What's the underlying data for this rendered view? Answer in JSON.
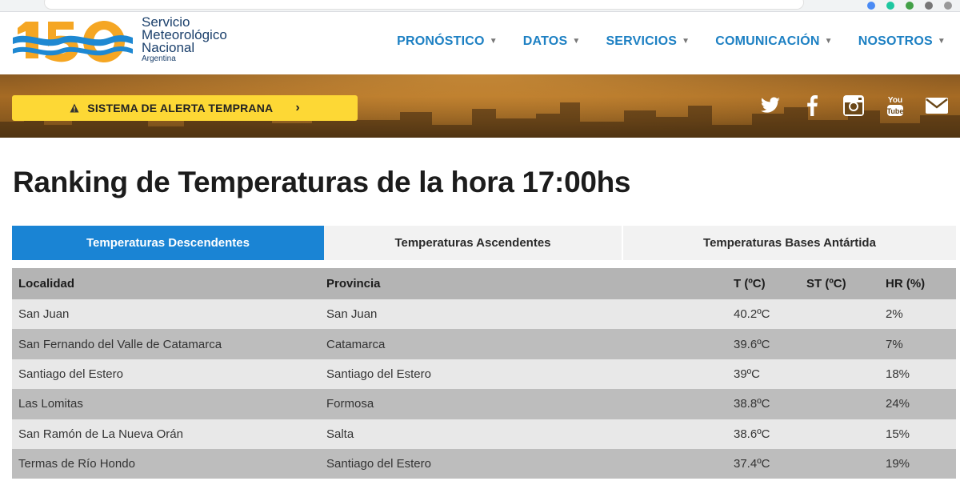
{
  "header": {
    "logo": {
      "number": "150",
      "line1": "Servicio",
      "line2": "Meteorológico",
      "line3": "Nacional",
      "line4": "Argentina"
    },
    "nav": [
      {
        "label": "PRONÓSTICO"
      },
      {
        "label": "DATOS"
      },
      {
        "label": "SERVICIOS"
      },
      {
        "label": "COMUNICACIÓN"
      },
      {
        "label": "NOSOTROS"
      }
    ]
  },
  "hero": {
    "alert_label": "SISTEMA DE ALERTA TEMPRANA",
    "social": [
      "twitter-icon",
      "facebook-icon",
      "instagram-icon",
      "youtube-icon",
      "email-icon"
    ]
  },
  "page": {
    "title": "Ranking de Temperaturas de la hora 17:00hs"
  },
  "tabs": [
    {
      "label": "Temperaturas Descendentes",
      "active": true
    },
    {
      "label": "Temperaturas Ascendentes",
      "active": false
    },
    {
      "label": "Temperaturas Bases Antártida",
      "active": false
    }
  ],
  "table": {
    "columns": [
      "Localidad",
      "Provincia",
      "T (ºC)",
      "ST (ºC)",
      "HR (%)"
    ],
    "rows": [
      {
        "localidad": "San Juan",
        "provincia": "San Juan",
        "t": "40.2ºC",
        "st": "",
        "hr": "2%"
      },
      {
        "localidad": "San Fernando del Valle de Catamarca",
        "provincia": "Catamarca",
        "t": "39.6ºC",
        "st": "",
        "hr": "7%"
      },
      {
        "localidad": "Santiago del Estero",
        "provincia": "Santiago del Estero",
        "t": "39ºC",
        "st": "",
        "hr": "18%"
      },
      {
        "localidad": "Las Lomitas",
        "provincia": "Formosa",
        "t": "38.8ºC",
        "st": "",
        "hr": "24%"
      },
      {
        "localidad": "San Ramón de La Nueva Orán",
        "provincia": "Salta",
        "t": "38.6ºC",
        "st": "",
        "hr": "15%"
      },
      {
        "localidad": "Termas de Río Hondo",
        "provincia": "Santiago del Estero",
        "t": "37.4ºC",
        "st": "",
        "hr": "19%"
      }
    ]
  },
  "colors": {
    "nav_blue": "#1d80c3",
    "tab_active": "#1a84d4",
    "alert_yellow": "#fdd835",
    "logo_orange": "#f5a623",
    "logo_blue": "#1e88d2"
  }
}
